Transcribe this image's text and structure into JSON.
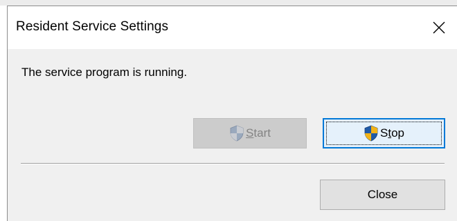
{
  "dialog": {
    "title": "Resident Service Settings",
    "close_glyph": "close-icon",
    "message": "The service program is running."
  },
  "buttons": {
    "start": {
      "label_mnemonic": "S",
      "label_rest": "tart",
      "enabled": false,
      "icon": "uac-shield-icon"
    },
    "stop": {
      "label_first": "S",
      "label_mnemonic": "t",
      "label_rest": "op",
      "enabled": true,
      "focused": true,
      "icon": "uac-shield-icon"
    },
    "close": {
      "label": "Close"
    }
  },
  "colors": {
    "accent": "#0078d7",
    "shield_blue": "#1f5aa8",
    "shield_gold": "#f2b318"
  }
}
